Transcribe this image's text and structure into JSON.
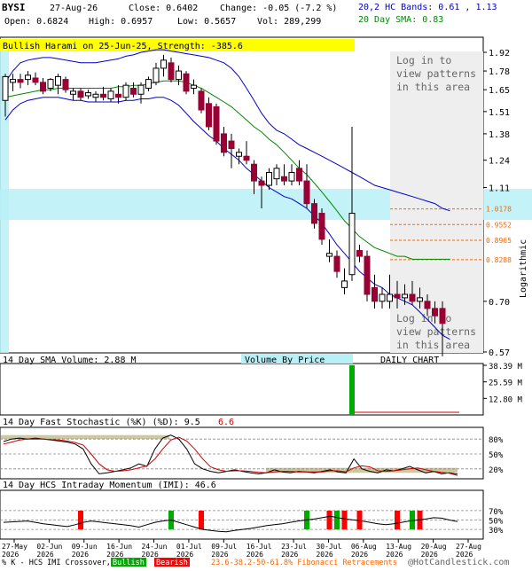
{
  "header": {
    "symbol": "BYSI",
    "date": "27-Aug-26",
    "close": "Close: 0.6402",
    "change": "Change: -0.05 (-7.2 %)",
    "open": "Open: 0.6824",
    "high": "High: 0.6957",
    "low": "Low: 0.5657",
    "vol": "Vol: 289,299",
    "bands_label": "20,2 HC Bands: 0.61 , 1.13",
    "sma_label": "20 Day SMA: 0.83"
  },
  "pattern_banner": "Bullish Harami on 25-Jun-25, Strength: -385.6",
  "login_note": {
    "line1": "Log in to",
    "line2": "view patterns",
    "line3": "in this area"
  },
  "colors": {
    "up_candle": "#ffffff",
    "down_candle": "#990033",
    "band_line": "#0000cc",
    "sma_line": "#008800",
    "fib_line": "#ff6600",
    "volume_bar": "#00aa00",
    "cyan_zone": "#b8f0f8",
    "stoch_fill": "#ccc8a0",
    "bull_bar": "#00aa00",
    "bear_bar": "#ff0000"
  },
  "chart_data": {
    "type": "candlestick",
    "scale": "logarithmic",
    "ylim": [
      0.57,
      1.92
    ],
    "y_ticks": [
      "1.92",
      "1.78",
      "1.65",
      "1.51",
      "1.38",
      "1.24",
      "1.11",
      "0.70",
      "0.57"
    ],
    "y_axis_label": "Logarithmic",
    "fib_levels": [
      "1.0178",
      "0.9552",
      "0.8965",
      "0.8288"
    ],
    "x_ticks": [
      "27-May 2026",
      "02-Jun 2026",
      "09-Jun 2026",
      "16-Jun 2026",
      "24-Jun 2026",
      "01-Jul 2026",
      "09-Jul 2026",
      "16-Jul 2026",
      "23-Jul 2026",
      "30-Jul 2026",
      "06-Aug 2026",
      "13-Aug 2026",
      "20-Aug 2026",
      "27-Aug 2026"
    ],
    "candles": [
      {
        "o": 1.58,
        "h": 1.76,
        "l": 1.48,
        "c": 1.74
      },
      {
        "o": 1.7,
        "h": 1.76,
        "l": 1.64,
        "c": 1.72
      },
      {
        "o": 1.72,
        "h": 1.76,
        "l": 1.66,
        "c": 1.7
      },
      {
        "o": 1.72,
        "h": 1.78,
        "l": 1.68,
        "c": 1.75
      },
      {
        "o": 1.73,
        "h": 1.77,
        "l": 1.68,
        "c": 1.7
      },
      {
        "o": 1.7,
        "h": 1.73,
        "l": 1.62,
        "c": 1.64
      },
      {
        "o": 1.66,
        "h": 1.73,
        "l": 1.64,
        "c": 1.72
      },
      {
        "o": 1.68,
        "h": 1.76,
        "l": 1.62,
        "c": 1.74
      },
      {
        "o": 1.72,
        "h": 1.74,
        "l": 1.63,
        "c": 1.65
      },
      {
        "o": 1.62,
        "h": 1.66,
        "l": 1.58,
        "c": 1.64
      },
      {
        "o": 1.64,
        "h": 1.66,
        "l": 1.58,
        "c": 1.6
      },
      {
        "o": 1.61,
        "h": 1.65,
        "l": 1.59,
        "c": 1.63
      },
      {
        "o": 1.6,
        "h": 1.64,
        "l": 1.57,
        "c": 1.62
      },
      {
        "o": 1.62,
        "h": 1.67,
        "l": 1.58,
        "c": 1.6
      },
      {
        "o": 1.59,
        "h": 1.66,
        "l": 1.57,
        "c": 1.64
      },
      {
        "o": 1.62,
        "h": 1.68,
        "l": 1.56,
        "c": 1.6
      },
      {
        "o": 1.6,
        "h": 1.7,
        "l": 1.58,
        "c": 1.68
      },
      {
        "o": 1.66,
        "h": 1.7,
        "l": 1.6,
        "c": 1.62
      },
      {
        "o": 1.62,
        "h": 1.7,
        "l": 1.56,
        "c": 1.68
      },
      {
        "o": 1.66,
        "h": 1.74,
        "l": 1.64,
        "c": 1.72
      },
      {
        "o": 1.7,
        "h": 1.84,
        "l": 1.68,
        "c": 1.8
      },
      {
        "o": 1.8,
        "h": 1.9,
        "l": 1.74,
        "c": 1.86
      },
      {
        "o": 1.84,
        "h": 1.88,
        "l": 1.7,
        "c": 1.72
      },
      {
        "o": 1.72,
        "h": 1.82,
        "l": 1.68,
        "c": 1.78
      },
      {
        "o": 1.76,
        "h": 1.78,
        "l": 1.62,
        "c": 1.64
      },
      {
        "o": 1.66,
        "h": 1.72,
        "l": 1.62,
        "c": 1.68
      },
      {
        "o": 1.64,
        "h": 1.66,
        "l": 1.5,
        "c": 1.52
      },
      {
        "o": 1.56,
        "h": 1.6,
        "l": 1.4,
        "c": 1.42
      },
      {
        "o": 1.54,
        "h": 1.56,
        "l": 1.32,
        "c": 1.34
      },
      {
        "o": 1.38,
        "h": 1.42,
        "l": 1.26,
        "c": 1.28
      },
      {
        "o": 1.34,
        "h": 1.38,
        "l": 1.2,
        "c": 1.3
      },
      {
        "o": 1.26,
        "h": 1.3,
        "l": 1.22,
        "c": 1.28
      },
      {
        "o": 1.26,
        "h": 1.34,
        "l": 1.22,
        "c": 1.24
      },
      {
        "o": 1.22,
        "h": 1.24,
        "l": 1.08,
        "c": 1.14
      },
      {
        "o": 1.14,
        "h": 1.16,
        "l": 1.02,
        "c": 1.12
      },
      {
        "o": 1.12,
        "h": 1.2,
        "l": 1.1,
        "c": 1.18
      },
      {
        "o": 1.15,
        "h": 1.22,
        "l": 1.12,
        "c": 1.2
      },
      {
        "o": 1.16,
        "h": 1.22,
        "l": 1.12,
        "c": 1.14
      },
      {
        "o": 1.14,
        "h": 1.22,
        "l": 1.12,
        "c": 1.18
      },
      {
        "o": 1.2,
        "h": 1.24,
        "l": 1.12,
        "c": 1.14
      },
      {
        "o": 1.14,
        "h": 1.22,
        "l": 1.02,
        "c": 1.04
      },
      {
        "o": 1.04,
        "h": 1.06,
        "l": 0.94,
        "c": 0.96
      },
      {
        "o": 1.0,
        "h": 1.02,
        "l": 0.88,
        "c": 0.9
      },
      {
        "o": 0.84,
        "h": 0.9,
        "l": 0.82,
        "c": 0.85
      },
      {
        "o": 0.84,
        "h": 0.86,
        "l": 0.77,
        "c": 0.79
      },
      {
        "o": 0.74,
        "h": 0.8,
        "l": 0.72,
        "c": 0.76
      },
      {
        "o": 0.78,
        "h": 1.42,
        "l": 0.76,
        "c": 1.0
      },
      {
        "o": 0.86,
        "h": 0.88,
        "l": 0.82,
        "c": 0.84
      },
      {
        "o": 0.84,
        "h": 0.86,
        "l": 0.7,
        "c": 0.72
      },
      {
        "o": 0.74,
        "h": 0.78,
        "l": 0.68,
        "c": 0.7
      },
      {
        "o": 0.7,
        "h": 0.74,
        "l": 0.68,
        "c": 0.72
      },
      {
        "o": 0.7,
        "h": 0.78,
        "l": 0.68,
        "c": 0.72
      },
      {
        "o": 0.72,
        "h": 0.76,
        "l": 0.68,
        "c": 0.71
      },
      {
        "o": 0.71,
        "h": 0.75,
        "l": 0.69,
        "c": 0.72
      },
      {
        "o": 0.72,
        "h": 0.76,
        "l": 0.69,
        "c": 0.7
      },
      {
        "o": 0.7,
        "h": 0.74,
        "l": 0.68,
        "c": 0.71
      },
      {
        "o": 0.7,
        "h": 0.72,
        "l": 0.66,
        "c": 0.68
      },
      {
        "o": 0.68,
        "h": 0.7,
        "l": 0.64,
        "c": 0.66
      },
      {
        "o": 0.68,
        "h": 0.7,
        "l": 0.56,
        "c": 0.64
      }
    ],
    "upper_band": [
      1.7,
      1.78,
      1.84,
      1.86,
      1.87,
      1.88,
      1.88,
      1.87,
      1.86,
      1.85,
      1.84,
      1.84,
      1.84,
      1.85,
      1.86,
      1.87,
      1.89,
      1.9,
      1.92,
      1.93,
      1.94,
      1.94,
      1.93,
      1.92,
      1.91,
      1.9,
      1.89,
      1.88,
      1.86,
      1.84,
      1.8,
      1.74,
      1.66,
      1.58,
      1.5,
      1.44,
      1.4,
      1.38,
      1.35,
      1.32,
      1.3,
      1.28,
      1.26,
      1.24,
      1.22,
      1.2,
      1.18,
      1.16,
      1.14,
      1.12,
      1.11,
      1.1,
      1.09,
      1.08,
      1.07,
      1.06,
      1.05,
      1.04,
      1.02,
      1.01
    ],
    "lower_band": [
      1.46,
      1.52,
      1.56,
      1.58,
      1.59,
      1.6,
      1.6,
      1.6,
      1.59,
      1.58,
      1.58,
      1.57,
      1.57,
      1.57,
      1.57,
      1.57,
      1.58,
      1.58,
      1.59,
      1.59,
      1.6,
      1.6,
      1.58,
      1.55,
      1.5,
      1.45,
      1.41,
      1.37,
      1.34,
      1.3,
      1.27,
      1.24,
      1.2,
      1.17,
      1.14,
      1.11,
      1.09,
      1.07,
      1.06,
      1.04,
      1.02,
      0.99,
      0.96,
      0.92,
      0.88,
      0.85,
      0.82,
      0.79,
      0.77,
      0.75,
      0.74,
      0.72,
      0.71,
      0.7,
      0.69,
      0.67,
      0.65,
      0.63,
      0.61,
      0.6
    ],
    "sma20": [
      1.6,
      1.61,
      1.62,
      1.63,
      1.64,
      1.65,
      1.65,
      1.66,
      1.66,
      1.66,
      1.66,
      1.66,
      1.66,
      1.66,
      1.66,
      1.67,
      1.67,
      1.68,
      1.68,
      1.69,
      1.7,
      1.71,
      1.71,
      1.71,
      1.7,
      1.68,
      1.66,
      1.63,
      1.6,
      1.57,
      1.54,
      1.5,
      1.46,
      1.42,
      1.39,
      1.35,
      1.32,
      1.28,
      1.24,
      1.2,
      1.17,
      1.13,
      1.09,
      1.05,
      1.01,
      0.97,
      0.94,
      0.91,
      0.89,
      0.87,
      0.86,
      0.85,
      0.84,
      0.84,
      0.83,
      0.83,
      0.83,
      0.83,
      0.83,
      0.83
    ],
    "volume_label": "14 Day SMA Volume: 2.88 M",
    "volume_by_price": "Volume By Price",
    "daily_chart": "DAILY CHART",
    "volume_ticks": [
      "38.39 M",
      "25.59 M",
      "12.80 M"
    ],
    "volume_spike": {
      "index": 46,
      "value_m": 38.4
    },
    "stoch_label": "14 Day Fast Stochastic (%K) (%D): 9.5",
    "stoch_d_value": "6.6",
    "stoch_ticks": [
      "80%",
      "50%",
      "20%"
    ],
    "stoch_k": [
      75,
      80,
      82,
      80,
      82,
      80,
      78,
      76,
      74,
      70,
      60,
      30,
      10,
      12,
      15,
      18,
      22,
      30,
      25,
      60,
      82,
      88,
      80,
      60,
      30,
      20,
      15,
      12,
      15,
      18,
      15,
      12,
      10,
      12,
      18,
      14,
      12,
      15,
      14,
      12,
      15,
      18,
      14,
      12,
      40,
      20,
      15,
      12,
      18,
      16,
      20,
      25,
      18,
      12,
      15,
      10,
      12,
      9.5
    ],
    "stoch_d": [
      70,
      74,
      78,
      80,
      80,
      80,
      79,
      78,
      76,
      73,
      68,
      50,
      30,
      18,
      15,
      16,
      18,
      22,
      26,
      40,
      60,
      78,
      84,
      76,
      60,
      40,
      24,
      18,
      15,
      16,
      16,
      15,
      13,
      12,
      14,
      15,
      15,
      14,
      14,
      14,
      14,
      16,
      16,
      14,
      22,
      26,
      24,
      16,
      15,
      16,
      18,
      20,
      22,
      18,
      15,
      13,
      11,
      6.6
    ],
    "imi_label": "14 Day HCS Intraday Momentum (IMI): 46.6",
    "imi_ticks": [
      "70%",
      "50%",
      "30%"
    ],
    "imi": [
      45,
      46,
      47,
      48,
      45,
      42,
      40,
      38,
      36,
      40,
      45,
      48,
      46,
      44,
      42,
      40,
      38,
      35,
      40,
      45,
      48,
      50,
      45,
      40,
      35,
      30,
      28,
      26,
      25,
      28,
      30,
      32,
      35,
      38,
      40,
      42,
      45,
      48,
      50,
      52,
      55,
      58,
      55,
      52,
      50,
      48,
      45,
      42,
      40,
      42,
      45,
      48,
      50,
      52,
      55,
      54,
      50,
      46.6
    ],
    "imi_bull_bars": [
      22,
      40,
      44,
      54
    ],
    "imi_bear_bars": [
      10,
      26,
      43,
      45,
      47,
      52,
      55
    ]
  },
  "footer": {
    "legend_prefix": "% K - HCS IMI Crossover,",
    "bullish": "Bullish",
    "bearish": "Bearish",
    "fib_note": "23.6-38.2-50-61.8% Fibonacci Retracements",
    "copyright": "@HotCandlestick.com"
  }
}
